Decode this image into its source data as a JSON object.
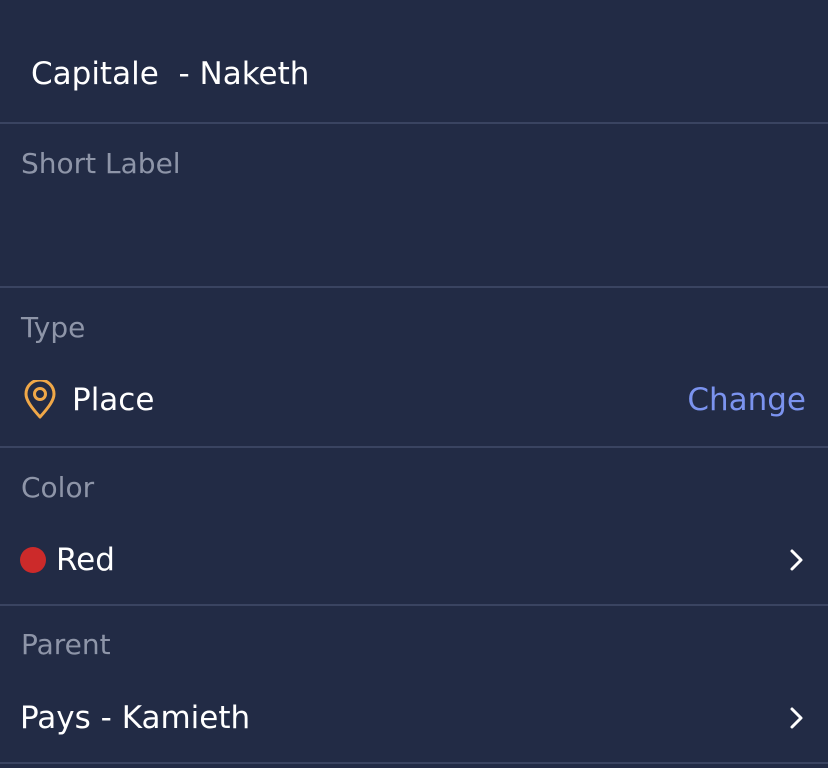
{
  "header": {
    "title": "Capitale  - Naketh"
  },
  "short_label": {
    "label": "Short Label",
    "value": ""
  },
  "type": {
    "label": "Type",
    "value": "Place",
    "icon": "map-pin-icon",
    "action_label": "Change",
    "icon_color": "#f0a848",
    "action_color": "#7b93ef"
  },
  "color": {
    "label": "Color",
    "value": "Red",
    "swatch": "#cc2a2a",
    "icon": "chevron-right-icon"
  },
  "parent": {
    "label": "Parent",
    "value": "Pays - Kamieth",
    "icon": "chevron-right-icon"
  }
}
